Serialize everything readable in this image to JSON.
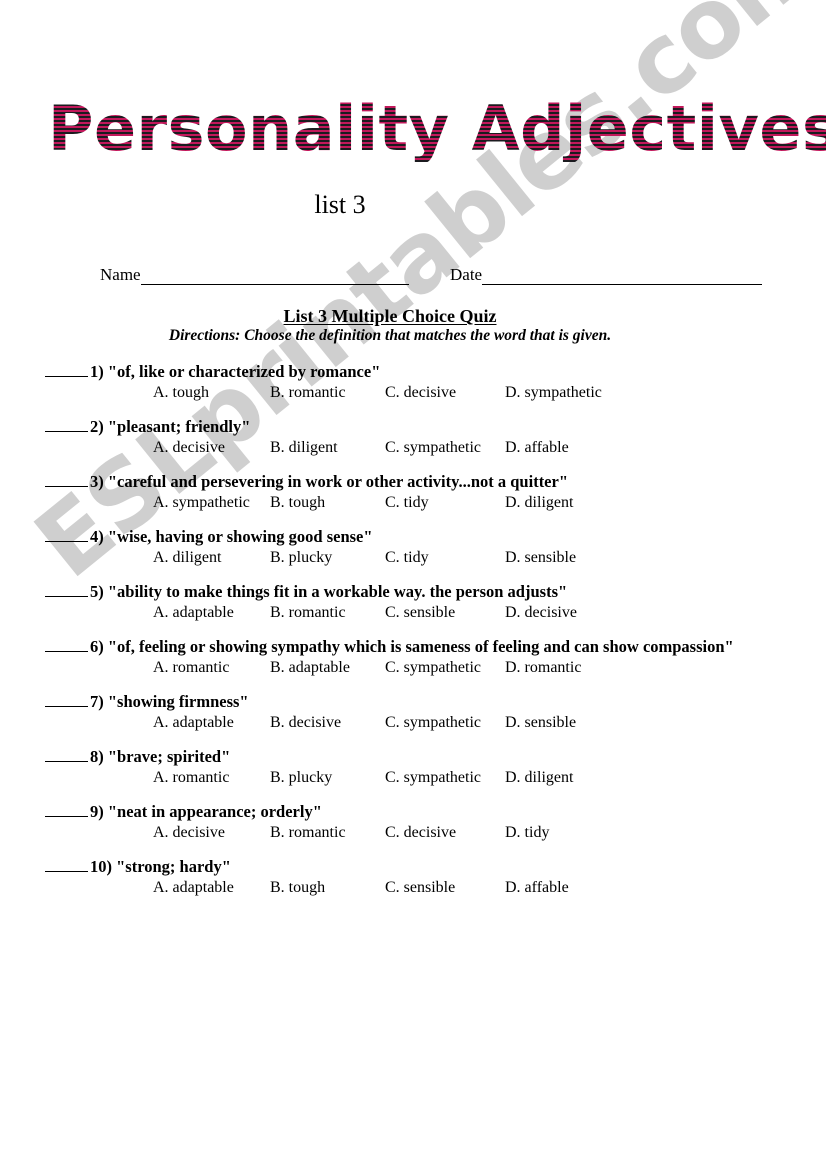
{
  "document": {
    "title": "Personality Adjectives",
    "subtitle": "list 3",
    "quiz_heading": "List 3 Multiple Choice Quiz",
    "directions": "Directions: Choose the definition that matches the word that is given.",
    "watermark": "ESLprintables.com"
  },
  "colors": {
    "title_dark": "#1b1b1f",
    "title_accent": "#c2185b",
    "watermark": "#cfcfcf",
    "text": "#000000",
    "page_background": "#ffffff"
  },
  "fields": [
    {
      "label": "Name",
      "value": ""
    },
    {
      "label": "Date",
      "value": ""
    }
  ],
  "questions": [
    {
      "number": "1)",
      "prompt": "\"of,  like or characterized by romance\"",
      "options": [
        "A. tough",
        "B. romantic",
        "C. decisive",
        "D. sympathetic"
      ]
    },
    {
      "number": "2)",
      "prompt": "\"pleasant; friendly\"",
      "options": [
        "A. decisive",
        "B. diligent",
        "C. sympathetic",
        "D. affable"
      ]
    },
    {
      "number": "3)",
      "prompt": "\"careful and persevering in work or other activity...not a quitter\"",
      "options": [
        "A. sympathetic",
        "B. tough",
        "C. tidy",
        "D. diligent"
      ]
    },
    {
      "number": "4)",
      "prompt": "\"wise, having or showing good sense\"",
      "options": [
        "A. diligent",
        "B. plucky",
        "C. tidy",
        "D. sensible"
      ]
    },
    {
      "number": "5)",
      "prompt": "\"ability to make things fit in a workable way.  the person adjusts\"",
      "options": [
        "A. adaptable",
        "B. romantic",
        "C. sensible",
        "D. decisive"
      ]
    },
    {
      "number": "6)",
      "prompt": "\"of, feeling or showing sympathy which is sameness of feeling and can show compassion\"",
      "options": [
        "A. romantic",
        "B. adaptable",
        "C. sympathetic",
        "D. romantic"
      ]
    },
    {
      "number": "7)",
      "prompt": "\"showing firmness\"",
      "options": [
        "A. adaptable",
        "B. decisive",
        "C. sympathetic",
        "D. sensible"
      ]
    },
    {
      "number": "8)",
      "prompt": "\"brave; spirited\"",
      "options": [
        "A. romantic",
        "B. plucky",
        "C. sympathetic",
        "D. diligent"
      ]
    },
    {
      "number": "9)",
      "prompt": "\"neat in appearance; orderly\"",
      "options": [
        "A. decisive",
        "B. romantic",
        "C. decisive",
        "D. tidy"
      ]
    },
    {
      "number": "10)",
      "prompt": "\"strong; hardy\"",
      "options": [
        "A. adaptable",
        "B. tough",
        "C. sensible",
        "D. affable"
      ]
    }
  ]
}
